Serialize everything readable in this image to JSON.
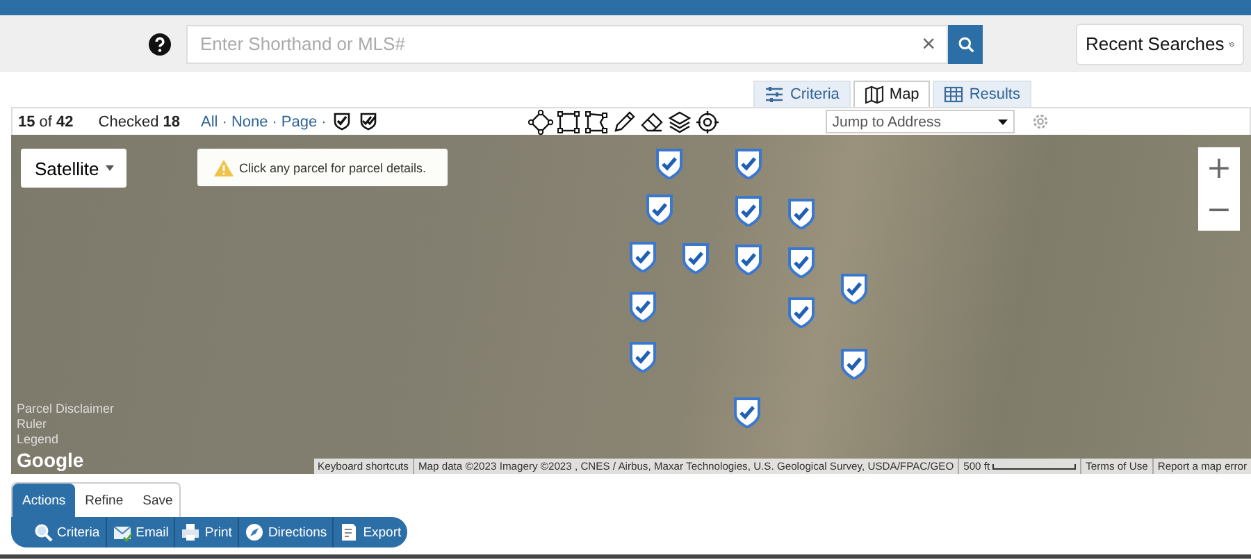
{
  "search": {
    "placeholder": "Enter Shorthand or MLS#",
    "clear": "×"
  },
  "recent_searches": "Recent Searches",
  "view_tabs": [
    {
      "label": "Criteria",
      "selected": false
    },
    {
      "label": "Map",
      "selected": true
    },
    {
      "label": "Results",
      "selected": false
    }
  ],
  "toolbar": {
    "count": "**15** of **42**",
    "checked": "Checked **18**",
    "select_links": [
      "All",
      "None",
      "Page"
    ],
    "separator": "·",
    "jump": {
      "placeholder": "Jump to Address"
    }
  },
  "map": {
    "map_type": "Satellite",
    "notice": "Click any parcel for parcel details.",
    "zoom_in": "+",
    "zoom_out": "−",
    "map_links": [
      "Parcel Disclaimer",
      "Ruler",
      "Legend"
    ],
    "logo": "Google",
    "attribution": {
      "shortcuts": "Keyboard shortcuts",
      "data": "Map data ©2023 Imagery ©2023 , CNES / Airbus, Maxar Technologies, U.S. Geological Survey, USDA/FPAC/GEO",
      "scale": "500 ft",
      "terms": "Terms of Use",
      "report": "Report a map error"
    }
  },
  "panel_tabs": [
    {
      "label": "Actions",
      "selected": true
    },
    {
      "label": "Refine",
      "selected": false
    },
    {
      "label": "Save",
      "selected": false
    }
  ],
  "actions": [
    {
      "label": "Criteria",
      "kind": "search"
    },
    {
      "label": "Email",
      "kind": "email"
    },
    {
      "label": "Print",
      "kind": "print"
    },
    {
      "label": "Directions",
      "kind": "compass"
    },
    {
      "label": "Export",
      "kind": "export"
    }
  ]
}
